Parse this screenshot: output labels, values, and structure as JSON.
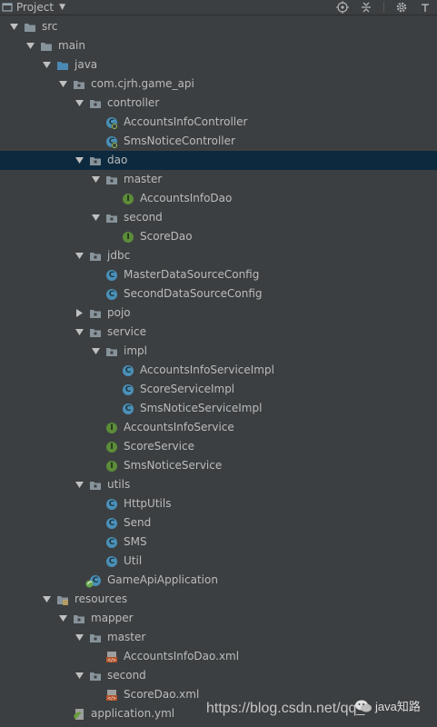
{
  "panel": {
    "title": "Project"
  },
  "colors": {
    "background": "#3c3f41",
    "selected_row": "#0d293e",
    "text": "#bbbbbb",
    "class_icon": "#4a90b8",
    "interface_icon": "#5c8c3a",
    "xml_icon": "#b5532a",
    "yml_icon": "#6a9b3c"
  },
  "tree": [
    {
      "label": "src",
      "icon": "folder-icon",
      "expanded": true
    },
    {
      "label": "main",
      "icon": "folder-icon",
      "expanded": true
    },
    {
      "label": "java",
      "icon": "source-folder-icon",
      "expanded": true
    },
    {
      "label": "com.cjrh.game_api",
      "icon": "package-icon",
      "expanded": true
    },
    {
      "label": "controller",
      "icon": "package-icon",
      "expanded": true
    },
    {
      "label": "AccountsInfoController",
      "icon": "spring-class-icon"
    },
    {
      "label": "SmsNoticeController",
      "icon": "spring-class-icon"
    },
    {
      "label": "dao",
      "icon": "package-icon",
      "expanded": true,
      "selected": true
    },
    {
      "label": "master",
      "icon": "package-icon",
      "expanded": true
    },
    {
      "label": "AccountsInfoDao",
      "icon": "interface-icon"
    },
    {
      "label": "second",
      "icon": "package-icon",
      "expanded": true
    },
    {
      "label": "ScoreDao",
      "icon": "interface-icon"
    },
    {
      "label": "jdbc",
      "icon": "package-icon",
      "expanded": true
    },
    {
      "label": "MasterDataSourceConfig",
      "icon": "class-icon"
    },
    {
      "label": "SecondDataSourceConfig",
      "icon": "class-icon"
    },
    {
      "label": "pojo",
      "icon": "package-icon",
      "expanded": false
    },
    {
      "label": "service",
      "icon": "package-icon",
      "expanded": true
    },
    {
      "label": "impl",
      "icon": "package-icon",
      "expanded": true
    },
    {
      "label": "AccountsInfoServiceImpl",
      "icon": "class-icon"
    },
    {
      "label": "ScoreServiceImpl",
      "icon": "class-icon"
    },
    {
      "label": "SmsNoticeServiceImpl",
      "icon": "class-icon"
    },
    {
      "label": "AccountsInfoService",
      "icon": "interface-icon"
    },
    {
      "label": "ScoreService",
      "icon": "interface-icon"
    },
    {
      "label": "SmsNoticeService",
      "icon": "interface-icon"
    },
    {
      "label": "utils",
      "icon": "package-icon",
      "expanded": true
    },
    {
      "label": "HttpUtils",
      "icon": "class-icon"
    },
    {
      "label": "Send",
      "icon": "class-icon"
    },
    {
      "label": "SMS",
      "icon": "class-icon"
    },
    {
      "label": "Util",
      "icon": "class-icon"
    },
    {
      "label": "GameApiApplication",
      "icon": "spring-boot-class-icon"
    },
    {
      "label": "resources",
      "icon": "resources-folder-icon",
      "expanded": true
    },
    {
      "label": "mapper",
      "icon": "package-icon",
      "expanded": true
    },
    {
      "label": "master",
      "icon": "package-icon",
      "expanded": true
    },
    {
      "label": "AccountsInfoDao.xml",
      "icon": "xml-file-icon"
    },
    {
      "label": "second",
      "icon": "package-icon",
      "expanded": true
    },
    {
      "label": "ScoreDao.xml",
      "icon": "xml-file-icon"
    },
    {
      "label": "application.yml",
      "icon": "yml-file-icon"
    }
  ],
  "watermark": {
    "url": "https://blog.csdn.net/qq_",
    "badge": "java知路"
  }
}
